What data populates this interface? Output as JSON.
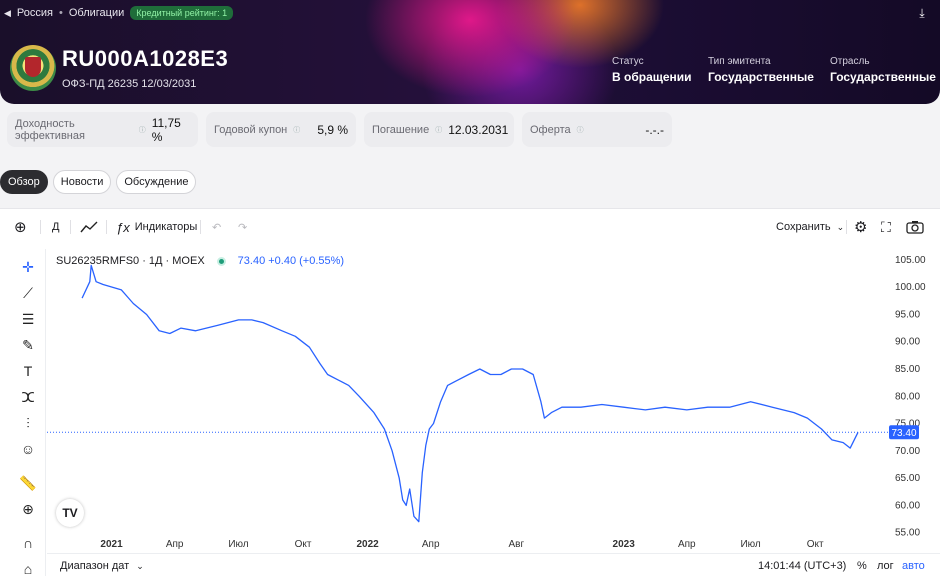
{
  "breadcrumb": {
    "country": "Россия",
    "section": "Облигации",
    "rating_badge": "Кредитный рейтинг: 1"
  },
  "bond": {
    "ticker": "RU000A1028E3",
    "name": "ОФЗ-ПД 26235 12/03/2031"
  },
  "meta": [
    {
      "label": "Статус",
      "value": "В обращении"
    },
    {
      "label": "Тип эмитента",
      "value": "Государственные"
    },
    {
      "label": "Отрасль",
      "value": "Государственные"
    }
  ],
  "stats": [
    {
      "label": "Доходность эффективная",
      "value": "11,75 %"
    },
    {
      "label": "Годовой купон",
      "value": "5,9 %"
    },
    {
      "label": "Погашение",
      "value": "12.03.2031"
    },
    {
      "label": "Оферта",
      "value": "-.-.-"
    }
  ],
  "tabs": [
    "Обзор",
    "Новости",
    "Обсуждение"
  ],
  "toolbar": {
    "interval": "Д",
    "indicators": "Индикаторы",
    "save": "Сохранить"
  },
  "legend": {
    "symbol": "SU26235RMFS0 · 1Д · MOEX",
    "quote": "73.40 +0.40 (+0.55%)"
  },
  "bottombar": {
    "range": "Диапазон дат",
    "clock": "14:01:44 (UTC+3)",
    "pct": "%",
    "log": "лог",
    "auto": "авто"
  },
  "colors": {
    "line": "#2962ff",
    "accent": "#2962ff"
  },
  "chart_data": {
    "type": "line",
    "x_ticks": [
      "2021",
      "Апр",
      "Июл",
      "Окт",
      "2022",
      "Апр",
      "Авг",
      "2023",
      "Апр",
      "Июл",
      "Окт"
    ],
    "y_ticks": [
      105,
      100,
      95,
      90,
      85,
      80,
      75,
      70,
      65,
      60,
      55
    ],
    "ylim": [
      52,
      107
    ],
    "last_value": "73.40",
    "series": [
      {
        "x": [
          "2020-11-20",
          "2020-12-01",
          "2020-12-03",
          "2020-12-10",
          "2020-12-20",
          "2021-01-15",
          "2021-02-01",
          "2021-02-20",
          "2021-03-10",
          "2021-03-25",
          "2021-04-10",
          "2021-05-01",
          "2021-06-01",
          "2021-07-01",
          "2021-07-20",
          "2021-08-05",
          "2021-09-01",
          "2021-09-20",
          "2021-10-10",
          "2021-10-25",
          "2021-11-05",
          "2021-11-20",
          "2021-12-05",
          "2021-12-20",
          "2022-01-10",
          "2022-01-25",
          "2022-02-05",
          "2022-02-15",
          "2022-02-20",
          "2022-02-25",
          "2022-03-02",
          "2022-03-08",
          "2022-03-15",
          "2022-03-20",
          "2022-03-25",
          "2022-03-30",
          "2022-04-05",
          "2022-04-15",
          "2022-04-25",
          "2022-05-10",
          "2022-05-25",
          "2022-06-10",
          "2022-06-25",
          "2022-07-10",
          "2022-07-25",
          "2022-08-10",
          "2022-08-25",
          "2022-09-05",
          "2022-09-10",
          "2022-09-20",
          "2022-10-05",
          "2022-11-01",
          "2022-12-01",
          "2023-01-01",
          "2023-02-01",
          "2023-03-01",
          "2023-04-01",
          "2023-05-01",
          "2023-06-01",
          "2023-07-01",
          "2023-08-01",
          "2023-09-01",
          "2023-09-20",
          "2023-10-10",
          "2023-10-25",
          "2023-11-10",
          "2023-11-20",
          "2023-12-01"
        ],
        "y": [
          98,
          101,
          104,
          101,
          100.5,
          99.5,
          97,
          95,
          92,
          91.5,
          92.5,
          92,
          93,
          94,
          94,
          93.5,
          92,
          91,
          89,
          86,
          84,
          83,
          82,
          80,
          77,
          74,
          70,
          65,
          61,
          60,
          63,
          58,
          57,
          66,
          71,
          74,
          75,
          79,
          82,
          83,
          84,
          85,
          84,
          84,
          85,
          85,
          84,
          79,
          76,
          77,
          78,
          78,
          78.5,
          78,
          77.5,
          78,
          77.5,
          78,
          78,
          79,
          78,
          77,
          76,
          74,
          72,
          71.5,
          70.5,
          73.4
        ]
      }
    ]
  }
}
